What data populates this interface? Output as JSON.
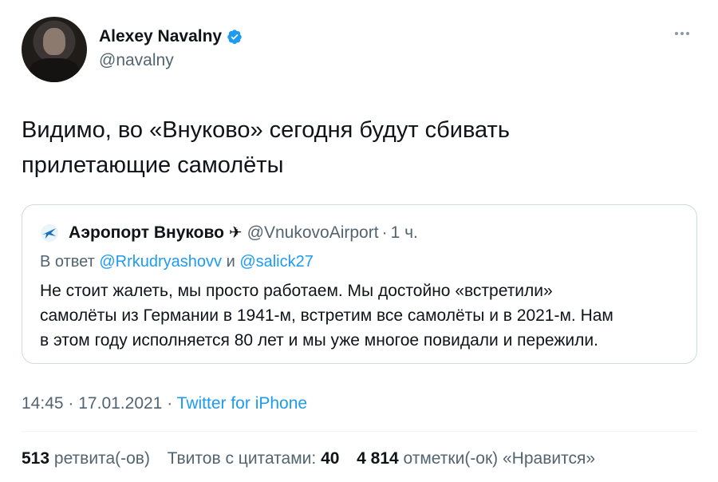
{
  "author": {
    "name": "Alexey Navalny",
    "handle": "@navalny",
    "verified_icon": "verified-badge-icon",
    "more_icon": "more-horizontal-icon"
  },
  "tweet": {
    "text_line1": "Видимо, во «Внуково» сегодня будут сбивать",
    "text_line2": "прилетающие самолёты"
  },
  "quoted": {
    "name": "Аэропорт Внуково",
    "emoji": "✈",
    "handle": "@VnukovoAirport",
    "separator": "·",
    "time": "1 ч.",
    "reply_prefix": "В ответ",
    "reply_user1": "@Rrkudryashovv",
    "reply_and": "и",
    "reply_user2": "@salick27",
    "text_line1": "Не стоит жалеть, мы просто работаем. Мы достойно «встретили»",
    "text_line2": "самолёты из Германии в 1941-м, встретим все самолёты и в 2021-м. Нам",
    "text_line3": "в этом году исполняется 80 лет и мы уже многое повидали и пережили."
  },
  "meta": {
    "time": "14:45",
    "sep": "·",
    "date": "17.01.2021",
    "source": "Twitter for iPhone"
  },
  "stats": {
    "retweets_count": "513",
    "retweets_label": "ретвита(-ов)",
    "quotes_label": "Твитов с цитатами:",
    "quotes_count": "40",
    "likes_count": "4 814",
    "likes_label": "отметки(-ок) «Нравится»"
  },
  "colors": {
    "accent": "#1d9bf0",
    "secondary_text": "#536471"
  }
}
